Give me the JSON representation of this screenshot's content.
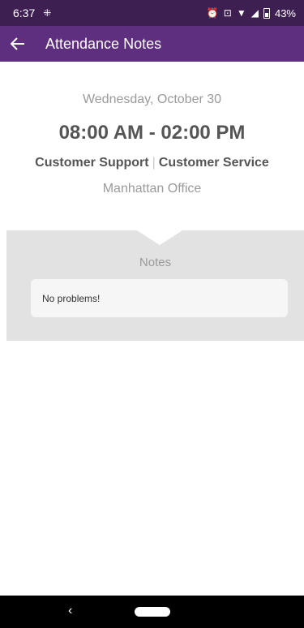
{
  "status_bar": {
    "time": "6:37",
    "battery_text": "43%"
  },
  "app_bar": {
    "title": "Attendance Notes",
    "back_icon": "arrow-left-icon"
  },
  "shift": {
    "date": "Wednesday, October 30",
    "time_range": "08:00 AM - 02:00 PM",
    "role_primary": "Customer Support",
    "role_separator": "|",
    "role_secondary": "Customer Service",
    "location": "Manhattan Office"
  },
  "notes": {
    "title": "Notes",
    "text": "No problems!"
  },
  "nav_bar": {
    "back_symbol": "‹"
  },
  "colors": {
    "status_bar_bg": "#3e1f52",
    "app_bar_bg": "#5e2f7e",
    "notes_bg": "#e2e2e2"
  }
}
